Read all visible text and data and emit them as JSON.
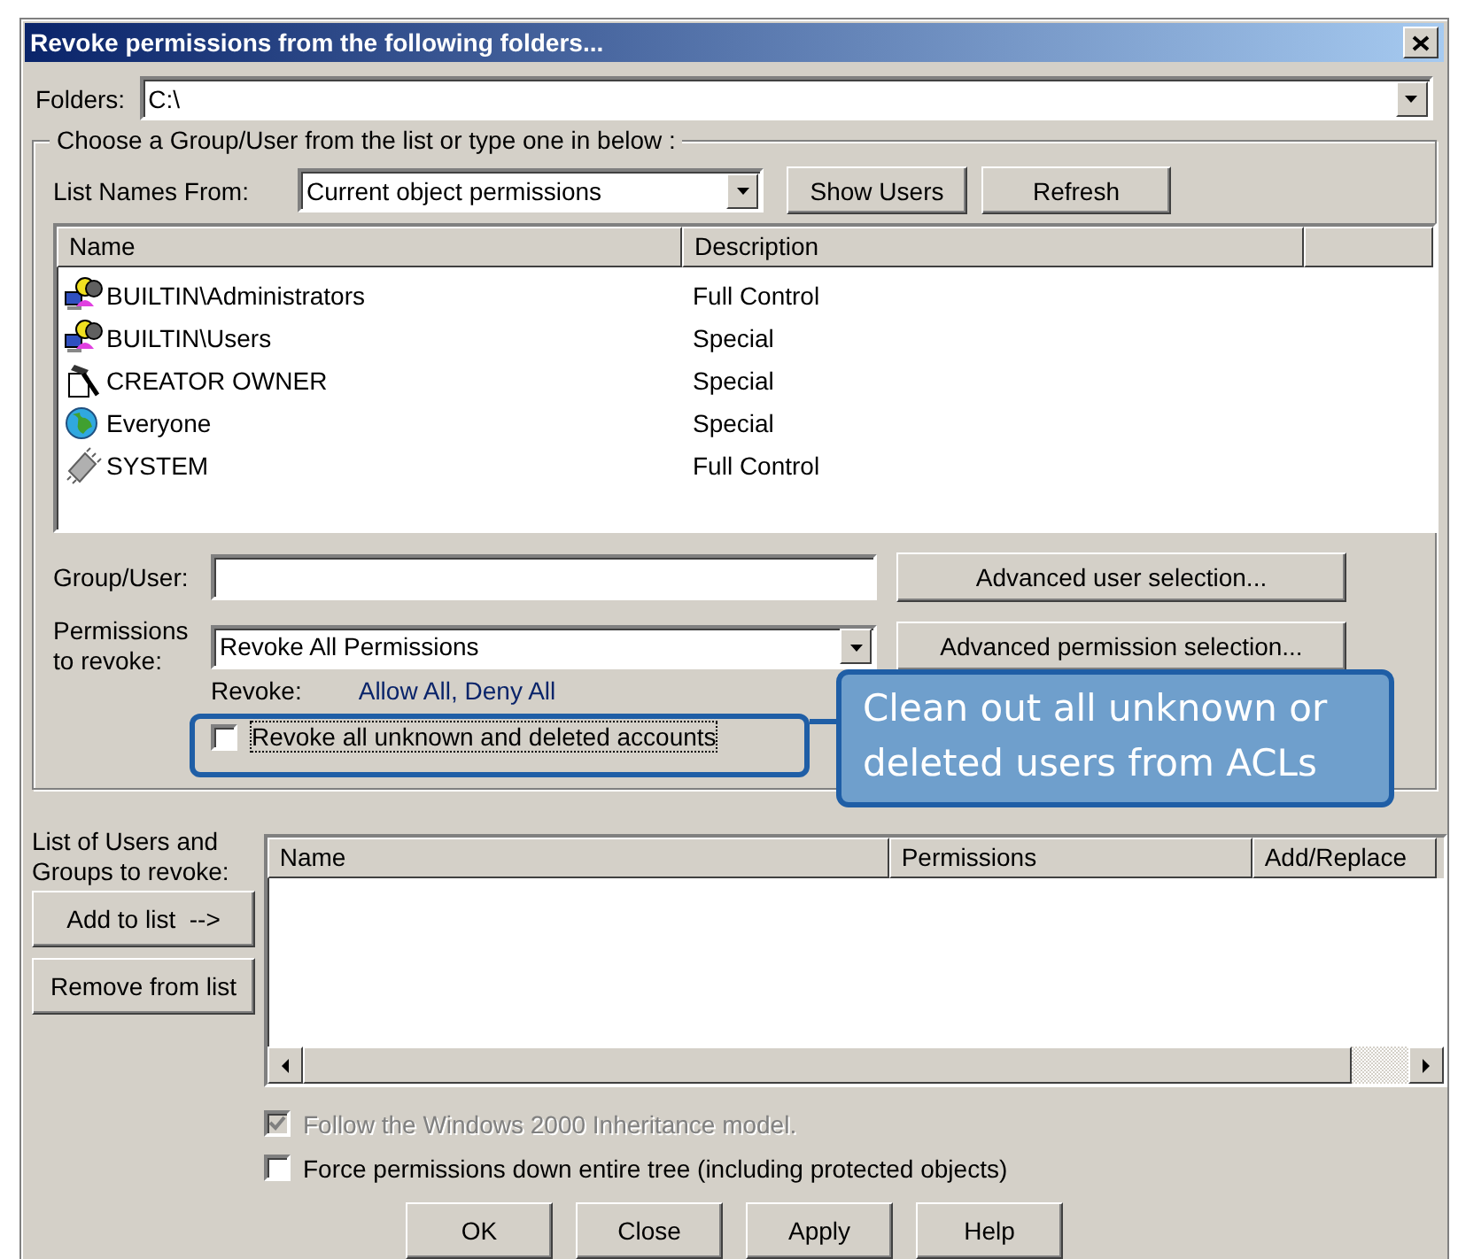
{
  "window": {
    "title": "Revoke permissions from the following folders..."
  },
  "folders": {
    "label": "Folders:",
    "value": "C:\\"
  },
  "group_box": {
    "legend": "Choose a Group/User from the list or type one in below :",
    "list_names_from": {
      "label": "List Names From:",
      "value": "Current object permissions"
    },
    "buttons": [
      "Show Users",
      "Refresh"
    ],
    "names_list": {
      "columns": [
        "Name",
        "Description"
      ],
      "rows": [
        {
          "name": "BUILTIN\\Administrators",
          "description": "Full Control",
          "kind": "group"
        },
        {
          "name": "BUILTIN\\Users",
          "description": "Special",
          "kind": "group"
        },
        {
          "name": "CREATOR OWNER",
          "description": "Special",
          "kind": "creator"
        },
        {
          "name": "Everyone",
          "description": "Special",
          "kind": "globe"
        },
        {
          "name": "SYSTEM",
          "description": "Full Control",
          "kind": "system"
        }
      ]
    },
    "group_user": {
      "label": "Group/User:"
    },
    "advanced_user_button": "Advanced user selection...",
    "permissions": {
      "label": "Permissions to revoke:",
      "value": "Revoke All Permissions"
    },
    "advanced_permission_button": "Advanced permission selection...",
    "revoke": {
      "label": "Revoke:",
      "value": "Allow All, Deny All"
    },
    "revoke_unknown": {
      "label": "Revoke all unknown and deleted accounts",
      "checked": false
    }
  },
  "callout": {
    "text": "Clean out all unknown or deleted users from ACLs"
  },
  "revoke_list": {
    "label": "List of Users and Groups to revoke:",
    "buttons": [
      "Add to list  -->",
      "Remove from list"
    ],
    "columns": [
      "Name",
      "Permissions",
      "Add/Replace"
    ]
  },
  "options": [
    {
      "label": "Follow the Windows 2000 Inheritance model.",
      "checked": true,
      "disabled": true
    },
    {
      "label": "Force permissions down entire tree (including protected objects)",
      "checked": false,
      "disabled": false
    }
  ],
  "buttons": [
    "OK",
    "Close",
    "Apply",
    "Help"
  ]
}
